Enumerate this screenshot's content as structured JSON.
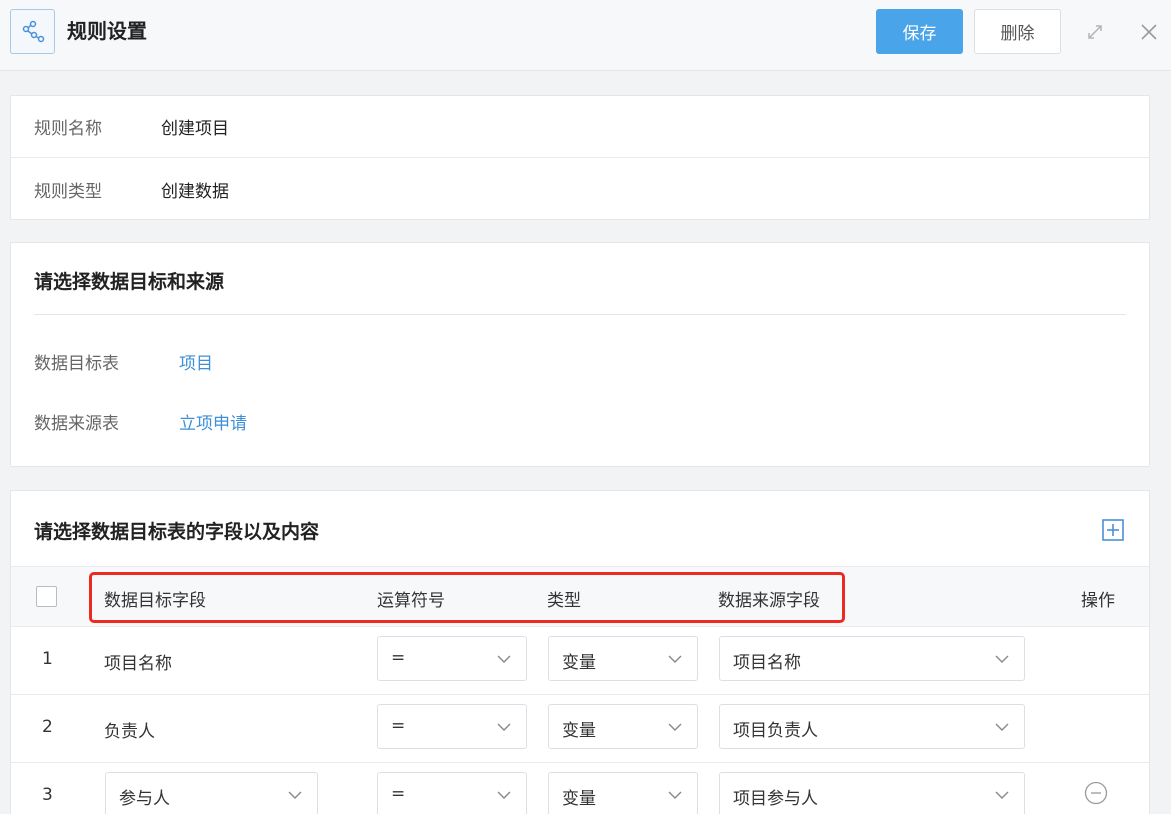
{
  "header": {
    "logo_icon": "flow-nodes-icon",
    "title": "规则设置",
    "save_label": "保存",
    "delete_label": "删除",
    "expand_icon": "expand-icon",
    "close_icon": "close-icon"
  },
  "rule_info": {
    "name_label": "规则名称",
    "name_value": "创建项目",
    "type_label": "规则类型",
    "type_value": "创建数据"
  },
  "source_section": {
    "title": "请选择数据目标和来源",
    "target_label": "数据目标表",
    "target_value": "项目",
    "source_label": "数据来源表",
    "source_value": "立项申请"
  },
  "fields_section": {
    "title": "请选择数据目标表的字段以及内容",
    "add_icon": "add-square-icon",
    "columns": {
      "target_field": "数据目标字段",
      "operator": "运算符号",
      "type": "类型",
      "source_field": "数据来源字段",
      "action": "操作"
    },
    "rows": [
      {
        "index": "1",
        "target_field": "项目名称",
        "operator": "=",
        "type": "变量",
        "source_field": "项目名称"
      },
      {
        "index": "2",
        "target_field": "负责人",
        "operator": "=",
        "type": "变量",
        "source_field": "项目负责人"
      },
      {
        "index": "3",
        "target_field": "参与人",
        "operator": "=",
        "type": "变量",
        "source_field": "项目参与人"
      }
    ]
  },
  "colors": {
    "accent": "#4aa4ea",
    "link": "#3d8fd8",
    "highlight": "#ec2a22"
  }
}
